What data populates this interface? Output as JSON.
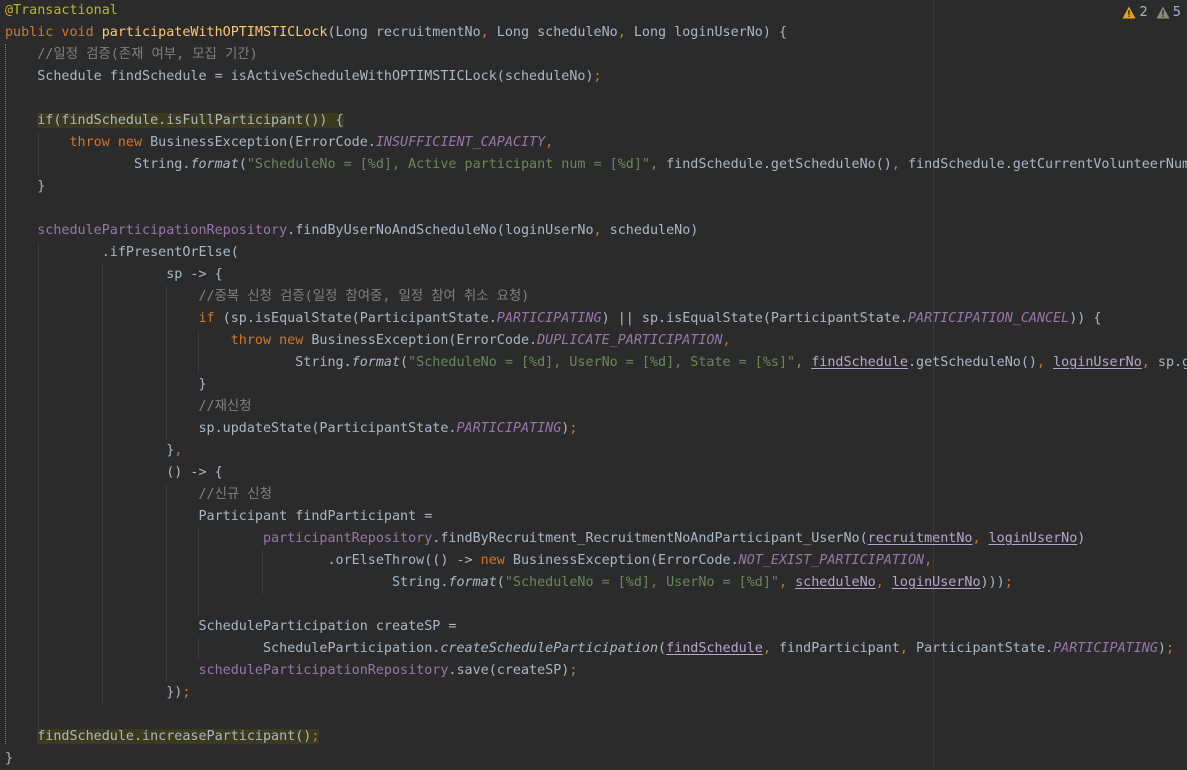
{
  "colors": {
    "background": "#2b2b2b",
    "plain": "#a9b7c6",
    "keyword": "#cc7832",
    "annotation": "#bbb529",
    "method_declaration": "#ffc66d",
    "comment": "#808080",
    "string": "#6a8759",
    "constant": "#9876aa",
    "warning_icon": "#e0a800"
  },
  "inspections": {
    "warnings_count": "2",
    "weak_warnings_count": "5"
  },
  "lines": [
    [
      [
        "@Transactional",
        "ann"
      ]
    ],
    [
      [
        "public void ",
        "kw"
      ],
      [
        "participateWithOPTIMSTICLock",
        "fn"
      ],
      [
        "(Long recruitmentNo",
        ""
      ],
      [
        ", ",
        "kw"
      ],
      [
        "Long scheduleNo",
        ""
      ],
      [
        ", ",
        "kw"
      ],
      [
        "Long loginUserNo) {",
        ""
      ]
    ],
    [
      [
        "    ",
        ""
      ],
      [
        "//일정 검증(존재 여부, 모집 기간)",
        "cmt"
      ]
    ],
    [
      [
        "    Schedule findSchedule = isActiveScheduleWithOPTIMSTICLock(scheduleNo)",
        ""
      ],
      [
        ";",
        "kw"
      ]
    ],
    [],
    [
      [
        "    ",
        ""
      ],
      [
        "if(findSchedule.isFullParticipant()) {",
        "hl"
      ]
    ],
    [
      [
        "        ",
        ""
      ],
      [
        "throw new ",
        "kw"
      ],
      [
        "BusinessException(ErrorCode.",
        ""
      ],
      [
        "INSUFFICIENT_CAPACITY",
        "const"
      ],
      [
        ",",
        "kw"
      ]
    ],
    [
      [
        "                String.",
        ""
      ],
      [
        "format",
        "static"
      ],
      [
        "(",
        ""
      ],
      [
        "\"ScheduleNo = [%d], Active participant num = [%d]\"",
        "str"
      ],
      [
        ", ",
        "kw"
      ],
      [
        "findSchedule.getScheduleNo()",
        ""
      ],
      [
        ", ",
        "kw"
      ],
      [
        "findSchedule.getCurrentVolunteerNum(",
        ""
      ]
    ],
    [
      [
        "    }",
        ""
      ]
    ],
    [],
    [
      [
        "    ",
        ""
      ],
      [
        "scheduleParticipationRepository",
        "field"
      ],
      [
        ".findByUserNoAndScheduleNo(loginUserNo",
        ""
      ],
      [
        ", ",
        "kw"
      ],
      [
        "scheduleNo)",
        ""
      ]
    ],
    [
      [
        "            .ifPresentOrElse(",
        ""
      ]
    ],
    [
      [
        "                    sp -> {",
        ""
      ]
    ],
    [
      [
        "                        ",
        ""
      ],
      [
        "//중복 신청 검증(일정 참여중, 일정 참여 취소 요청)",
        "cmt"
      ]
    ],
    [
      [
        "                        ",
        ""
      ],
      [
        "if ",
        "kw"
      ],
      [
        "(sp.isEqualState(ParticipantState.",
        ""
      ],
      [
        "PARTICIPATING",
        "const"
      ],
      [
        ") || sp.isEqualState(ParticipantState.",
        ""
      ],
      [
        "PARTICIPATION_CANCEL",
        "const"
      ],
      [
        ")) {",
        ""
      ]
    ],
    [
      [
        "                            ",
        ""
      ],
      [
        "throw new ",
        "kw"
      ],
      [
        "BusinessException(ErrorCode.",
        ""
      ],
      [
        "DUPLICATE_PARTICIPATION",
        "const"
      ],
      [
        ",",
        "kw"
      ]
    ],
    [
      [
        "                                    String.",
        ""
      ],
      [
        "format",
        "static"
      ],
      [
        "(",
        ""
      ],
      [
        "\"ScheduleNo = [%d], UserNo = [%d], State = [%s]\"",
        "str"
      ],
      [
        ", ",
        "kw"
      ],
      [
        "findSchedule",
        "ul"
      ],
      [
        ".getScheduleNo()",
        ""
      ],
      [
        ", ",
        "kw"
      ],
      [
        "loginUserNo",
        "ul"
      ],
      [
        ", ",
        "kw"
      ],
      [
        "sp.ge",
        ""
      ]
    ],
    [
      [
        "                        }",
        ""
      ]
    ],
    [
      [
        "                        ",
        ""
      ],
      [
        "//재신청",
        "cmt"
      ]
    ],
    [
      [
        "                        sp.updateState(ParticipantState.",
        ""
      ],
      [
        "PARTICIPATING",
        "const"
      ],
      [
        ")",
        ""
      ],
      [
        ";",
        "kw"
      ]
    ],
    [
      [
        "                    }",
        ""
      ],
      [
        ",",
        "kw"
      ]
    ],
    [
      [
        "                    () -> {",
        ""
      ]
    ],
    [
      [
        "                        ",
        ""
      ],
      [
        "//신규 신청",
        "cmt"
      ]
    ],
    [
      [
        "                        Participant findParticipant =",
        ""
      ]
    ],
    [
      [
        "                                ",
        ""
      ],
      [
        "participantRepository",
        "field"
      ],
      [
        ".findByRecruitment_RecruitmentNoAndParticipant_UserNo(",
        ""
      ],
      [
        "recruitmentNo",
        "ul"
      ],
      [
        ", ",
        "kw"
      ],
      [
        "loginUserNo",
        "ul"
      ],
      [
        ")",
        ""
      ]
    ],
    [
      [
        "                                        .orElseThrow(() -> ",
        ""
      ],
      [
        "new ",
        "kw"
      ],
      [
        "BusinessException(ErrorCode.",
        ""
      ],
      [
        "NOT_EXIST_PARTICIPATION",
        "const"
      ],
      [
        ",",
        "kw"
      ]
    ],
    [
      [
        "                                                String.",
        ""
      ],
      [
        "format",
        "static"
      ],
      [
        "(",
        ""
      ],
      [
        "\"ScheduleNo = [%d], UserNo = [%d]\"",
        "str"
      ],
      [
        ", ",
        "kw"
      ],
      [
        "scheduleNo",
        "ul"
      ],
      [
        ", ",
        "kw"
      ],
      [
        "loginUserNo",
        "ul"
      ],
      [
        ")))",
        ""
      ],
      [
        ";",
        "kw"
      ]
    ],
    [],
    [
      [
        "                        ScheduleParticipation createSP =",
        ""
      ]
    ],
    [
      [
        "                                ScheduleParticipation.",
        ""
      ],
      [
        "createScheduleParticipation",
        "static"
      ],
      [
        "(",
        ""
      ],
      [
        "findSchedule",
        "ul"
      ],
      [
        ", ",
        "kw"
      ],
      [
        "findParticipant",
        ""
      ],
      [
        ", ",
        "kw"
      ],
      [
        "ParticipantState.",
        ""
      ],
      [
        "PARTICIPATING",
        "const"
      ],
      [
        ")",
        ""
      ],
      [
        ";",
        "kw"
      ]
    ],
    [
      [
        "                        ",
        ""
      ],
      [
        "scheduleParticipationRepository",
        "field"
      ],
      [
        ".save(createSP)",
        ""
      ],
      [
        ";",
        "kw"
      ]
    ],
    [
      [
        "                    })",
        ""
      ],
      [
        ";",
        "kw"
      ]
    ],
    [],
    [
      [
        "    ",
        ""
      ],
      [
        "findSchedule.increaseParticipant()",
        "hl"
      ],
      [
        ";",
        "hlkw"
      ]
    ],
    [
      [
        "}",
        ""
      ]
    ]
  ]
}
